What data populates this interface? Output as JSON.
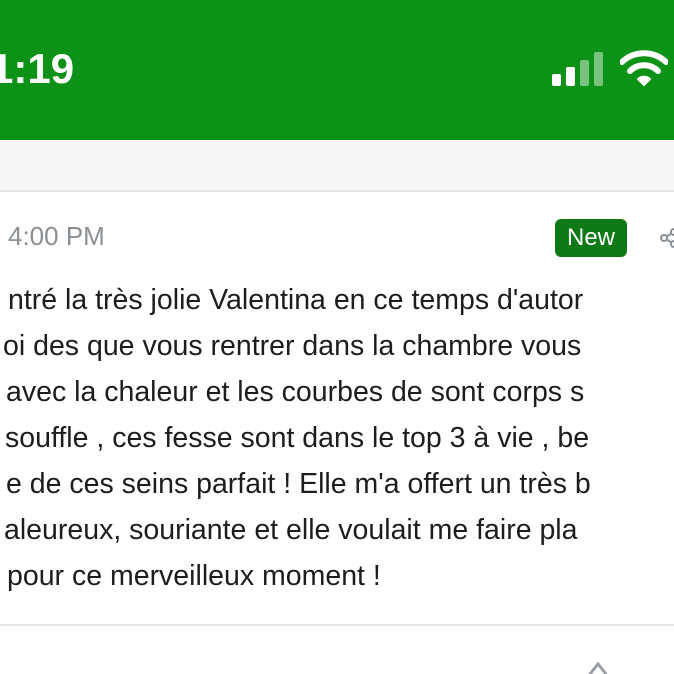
{
  "status_bar": {
    "time": "1:19",
    "background_color": "#0b9217",
    "signal_icon": "cellular-signal-icon",
    "wifi_icon": "wifi-icon"
  },
  "review": {
    "timestamp": "4:00 PM",
    "badge": "New",
    "badge_color": "#0d7a16",
    "share_icon": "share-icon",
    "lines": [
      "ntré la très jolie Valentina en ce temps d'autor",
      "oi des que vous rentrer dans la chambre vous",
      "avec la chaleur et les courbes de sont corps s",
      "souffle , ces fesse sont dans le top 3 à vie , be",
      "e de ces seins parfait ! Elle m'a offert un très b",
      "aleureux, souriante et elle voulait me faire pla",
      "pour ce merveilleux moment !"
    ]
  }
}
